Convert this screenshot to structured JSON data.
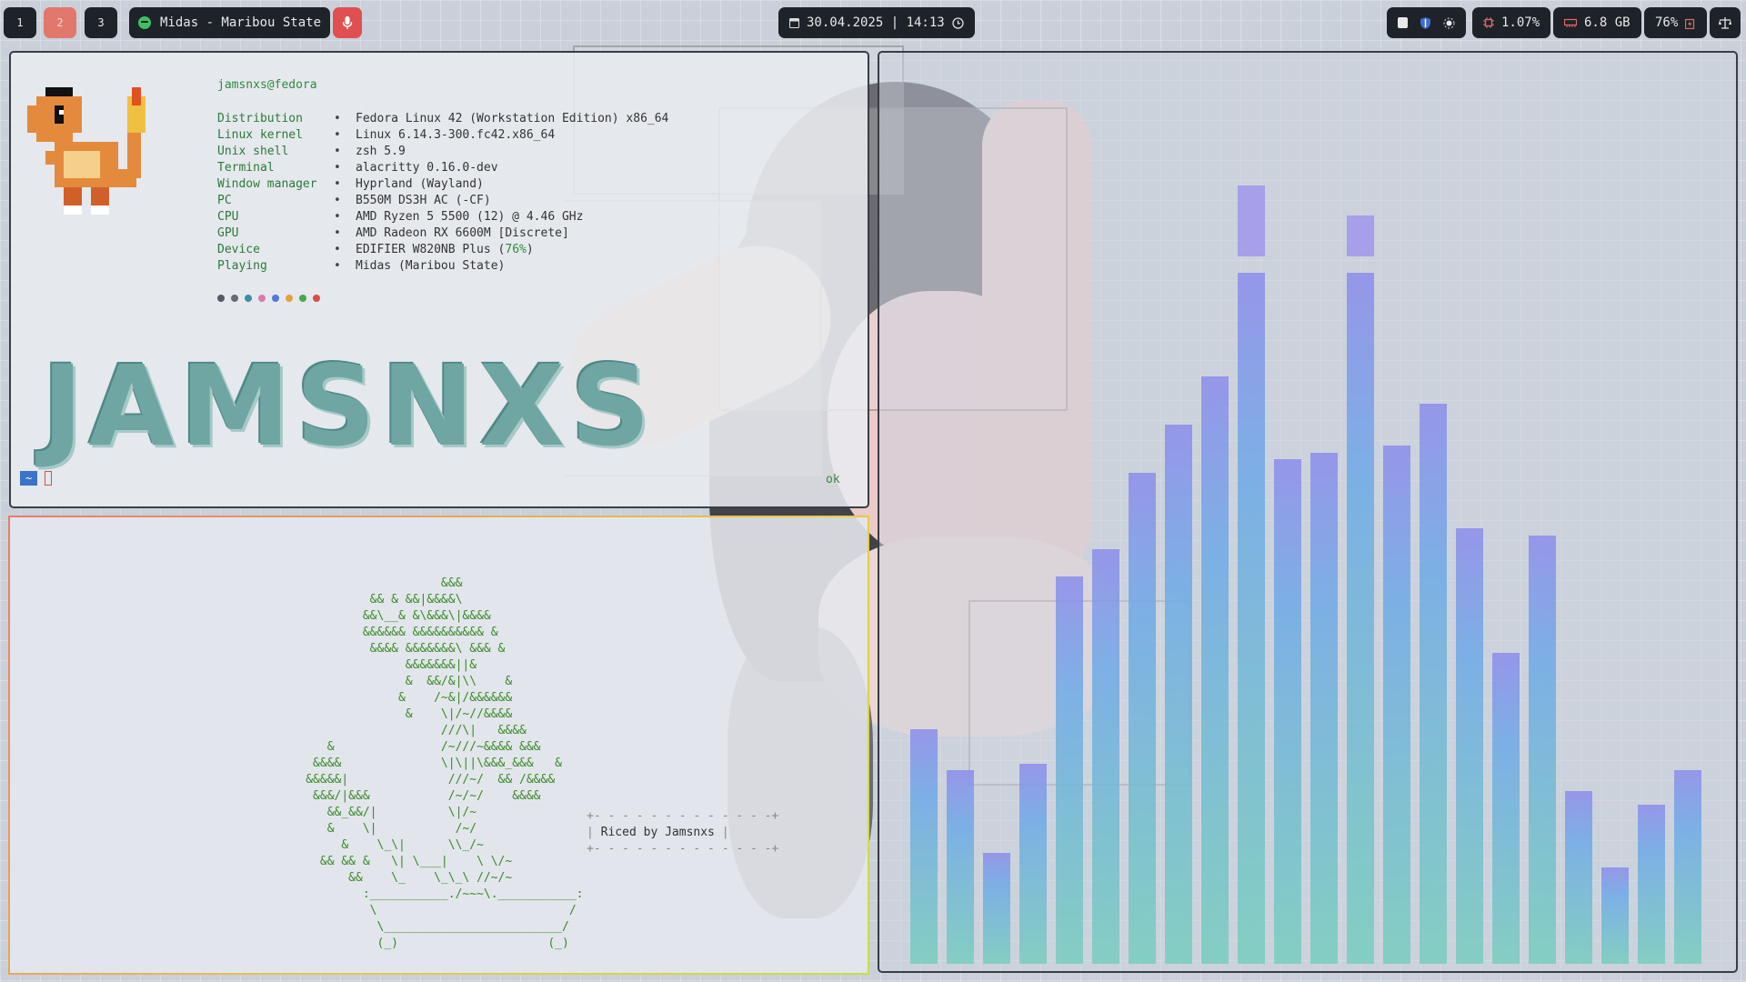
{
  "topbar": {
    "workspaces": [
      "1",
      "2",
      "3"
    ],
    "media": "Midas - Maribou State",
    "datetime": "30.04.2025 | 14:13",
    "cpu": "1.07%",
    "ram": "6.8 GB",
    "battery": "76%"
  },
  "fetch": {
    "user": "jamsnxs@fedora",
    "rows": [
      {
        "k": "Distribution",
        "v": "Fedora Linux 42 (Workstation Edition) x86_64"
      },
      {
        "k": "Linux kernel",
        "v": "Linux 6.14.3-300.fc42.x86_64"
      },
      {
        "k": "Unix shell",
        "v": "zsh 5.9"
      },
      {
        "k": "Terminal",
        "v": "alacritty 0.16.0-dev"
      },
      {
        "k": "Window manager",
        "v": "Hyprland (Wayland)"
      },
      {
        "k": "PC",
        "v": "B550M DS3H AC (-CF)"
      },
      {
        "k": "CPU",
        "v": "AMD Ryzen 5 5500 (12) @ 4.46 GHz"
      },
      {
        "k": "GPU",
        "v": "AMD Radeon RX 6600M [Discrete]"
      },
      {
        "k": "Device",
        "v": "EDIFIER W820NB Plus (",
        "pct": "76%",
        "tail": ")"
      },
      {
        "k": "Playing",
        "v": "Midas (Maribou State)"
      }
    ],
    "bullet": "•",
    "logo": "JAMSNXS",
    "prompt_tag": "~",
    "status": "ok",
    "dot_colors": [
      "#555a66",
      "#666b77",
      "#3d8fa0",
      "#d77bb3",
      "#4f7ad8",
      "#e3a33c",
      "#4aa84a",
      "#d94a4a"
    ]
  },
  "bonsai": {
    "caption": "Riced by Jamsnxs"
  },
  "cava": {
    "levels": [
      0.34,
      0.28,
      0.16,
      0.29,
      0.56,
      0.6,
      0.71,
      0.78,
      0.85,
      1.0,
      0.73,
      0.74,
      1.0,
      0.75,
      0.81,
      0.63,
      0.45,
      0.62,
      0.25,
      0.14,
      0.23,
      0.28
    ],
    "peaks": [
      0,
      0,
      0,
      0,
      0,
      0,
      0,
      0,
      0,
      1,
      0,
      0,
      1,
      0,
      0,
      0,
      0,
      0,
      0,
      0,
      0,
      0
    ]
  }
}
